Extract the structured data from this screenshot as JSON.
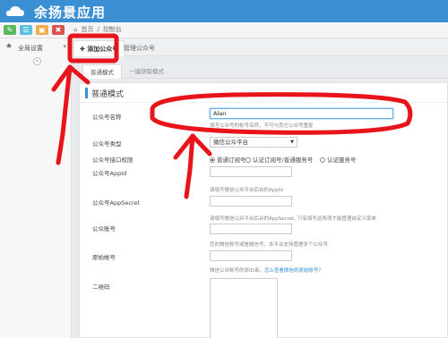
{
  "header": {
    "app_title": "余扬景应用",
    "logo_icon": "cloud-icon",
    "bg_color": "#3a8fd3"
  },
  "toolbar": {
    "buttons": [
      {
        "icon": "edit-icon",
        "color": "#5cb85c"
      },
      {
        "icon": "list-icon",
        "color": "#5bc0de"
      },
      {
        "icon": "folder-icon",
        "color": "#f0ad4e"
      },
      {
        "icon": "delete-icon",
        "color": "#d9534f"
      }
    ]
  },
  "breadcrumb": {
    "home": "首页",
    "sep": "/",
    "current": "控制台"
  },
  "sidebar": {
    "items": [
      {
        "label": "全局设置",
        "icon": "star-icon"
      }
    ],
    "toggle": "«"
  },
  "tabs": [
    {
      "label": "✚ 添加公众号",
      "active": true
    },
    {
      "label": "管理公众号",
      "active": false
    }
  ],
  "subtabs": [
    {
      "label": "普通模式",
      "active": true
    },
    {
      "label": "一键获取模式",
      "active": false
    }
  ],
  "panel": {
    "title": "普通模式"
  },
  "form": {
    "name_label": "公众号名称",
    "name_value": "Alan",
    "name_help": "填写公众号的帐号名称，不可与其它公众号重复",
    "type_label": "公众号类型",
    "type_value": "微信公众平台",
    "level_label": "公众号接口权限",
    "level_options": [
      "普通订阅号",
      "认证订阅号/普通服务号",
      "认证服务号"
    ],
    "level_selected": 0,
    "appid_label": "公众号AppId",
    "appid_help": "请填写微信公众平台后台的AppId",
    "secret_label": "公众号AppSecret",
    "secret_help": "请填写微信公众平台后台的AppSecret, 只有填写这两项才能管理自定义菜单",
    "account_label": "公众账号",
    "account_help": "您的微信账号或是微信号，本平台支持管理多个公众号",
    "original_label": "原始帐号",
    "original_help": "微信公众帐号的原ID串，",
    "original_link": "怎么查看微信的原始帐号？",
    "qr_label": "二维码"
  },
  "annotation_color": "#e8141b"
}
